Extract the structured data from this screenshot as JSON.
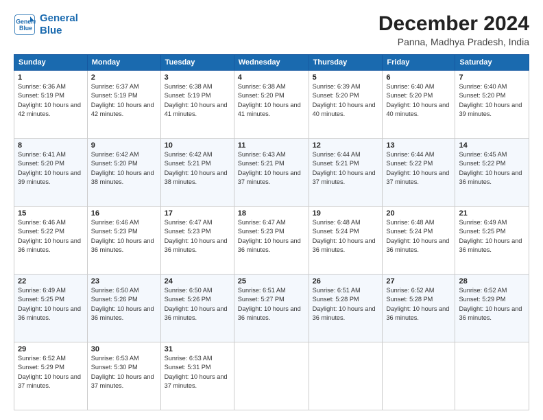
{
  "logo": {
    "line1": "General",
    "line2": "Blue"
  },
  "title": "December 2024",
  "subtitle": "Panna, Madhya Pradesh, India",
  "days_header": [
    "Sunday",
    "Monday",
    "Tuesday",
    "Wednesday",
    "Thursday",
    "Friday",
    "Saturday"
  ],
  "weeks": [
    [
      {
        "num": "1",
        "rise": "6:36 AM",
        "set": "5:19 PM",
        "daylight": "10 hours and 42 minutes."
      },
      {
        "num": "2",
        "rise": "6:37 AM",
        "set": "5:19 PM",
        "daylight": "10 hours and 42 minutes."
      },
      {
        "num": "3",
        "rise": "6:38 AM",
        "set": "5:19 PM",
        "daylight": "10 hours and 41 minutes."
      },
      {
        "num": "4",
        "rise": "6:38 AM",
        "set": "5:20 PM",
        "daylight": "10 hours and 41 minutes."
      },
      {
        "num": "5",
        "rise": "6:39 AM",
        "set": "5:20 PM",
        "daylight": "10 hours and 40 minutes."
      },
      {
        "num": "6",
        "rise": "6:40 AM",
        "set": "5:20 PM",
        "daylight": "10 hours and 40 minutes."
      },
      {
        "num": "7",
        "rise": "6:40 AM",
        "set": "5:20 PM",
        "daylight": "10 hours and 39 minutes."
      }
    ],
    [
      {
        "num": "8",
        "rise": "6:41 AM",
        "set": "5:20 PM",
        "daylight": "10 hours and 39 minutes."
      },
      {
        "num": "9",
        "rise": "6:42 AM",
        "set": "5:20 PM",
        "daylight": "10 hours and 38 minutes."
      },
      {
        "num": "10",
        "rise": "6:42 AM",
        "set": "5:21 PM",
        "daylight": "10 hours and 38 minutes."
      },
      {
        "num": "11",
        "rise": "6:43 AM",
        "set": "5:21 PM",
        "daylight": "10 hours and 37 minutes."
      },
      {
        "num": "12",
        "rise": "6:44 AM",
        "set": "5:21 PM",
        "daylight": "10 hours and 37 minutes."
      },
      {
        "num": "13",
        "rise": "6:44 AM",
        "set": "5:22 PM",
        "daylight": "10 hours and 37 minutes."
      },
      {
        "num": "14",
        "rise": "6:45 AM",
        "set": "5:22 PM",
        "daylight": "10 hours and 36 minutes."
      }
    ],
    [
      {
        "num": "15",
        "rise": "6:46 AM",
        "set": "5:22 PM",
        "daylight": "10 hours and 36 minutes."
      },
      {
        "num": "16",
        "rise": "6:46 AM",
        "set": "5:23 PM",
        "daylight": "10 hours and 36 minutes."
      },
      {
        "num": "17",
        "rise": "6:47 AM",
        "set": "5:23 PM",
        "daylight": "10 hours and 36 minutes."
      },
      {
        "num": "18",
        "rise": "6:47 AM",
        "set": "5:23 PM",
        "daylight": "10 hours and 36 minutes."
      },
      {
        "num": "19",
        "rise": "6:48 AM",
        "set": "5:24 PM",
        "daylight": "10 hours and 36 minutes."
      },
      {
        "num": "20",
        "rise": "6:48 AM",
        "set": "5:24 PM",
        "daylight": "10 hours and 36 minutes."
      },
      {
        "num": "21",
        "rise": "6:49 AM",
        "set": "5:25 PM",
        "daylight": "10 hours and 36 minutes."
      }
    ],
    [
      {
        "num": "22",
        "rise": "6:49 AM",
        "set": "5:25 PM",
        "daylight": "10 hours and 36 minutes."
      },
      {
        "num": "23",
        "rise": "6:50 AM",
        "set": "5:26 PM",
        "daylight": "10 hours and 36 minutes."
      },
      {
        "num": "24",
        "rise": "6:50 AM",
        "set": "5:26 PM",
        "daylight": "10 hours and 36 minutes."
      },
      {
        "num": "25",
        "rise": "6:51 AM",
        "set": "5:27 PM",
        "daylight": "10 hours and 36 minutes."
      },
      {
        "num": "26",
        "rise": "6:51 AM",
        "set": "5:28 PM",
        "daylight": "10 hours and 36 minutes."
      },
      {
        "num": "27",
        "rise": "6:52 AM",
        "set": "5:28 PM",
        "daylight": "10 hours and 36 minutes."
      },
      {
        "num": "28",
        "rise": "6:52 AM",
        "set": "5:29 PM",
        "daylight": "10 hours and 36 minutes."
      }
    ],
    [
      {
        "num": "29",
        "rise": "6:52 AM",
        "set": "5:29 PM",
        "daylight": "10 hours and 37 minutes."
      },
      {
        "num": "30",
        "rise": "6:53 AM",
        "set": "5:30 PM",
        "daylight": "10 hours and 37 minutes."
      },
      {
        "num": "31",
        "rise": "6:53 AM",
        "set": "5:31 PM",
        "daylight": "10 hours and 37 minutes."
      },
      null,
      null,
      null,
      null
    ]
  ]
}
